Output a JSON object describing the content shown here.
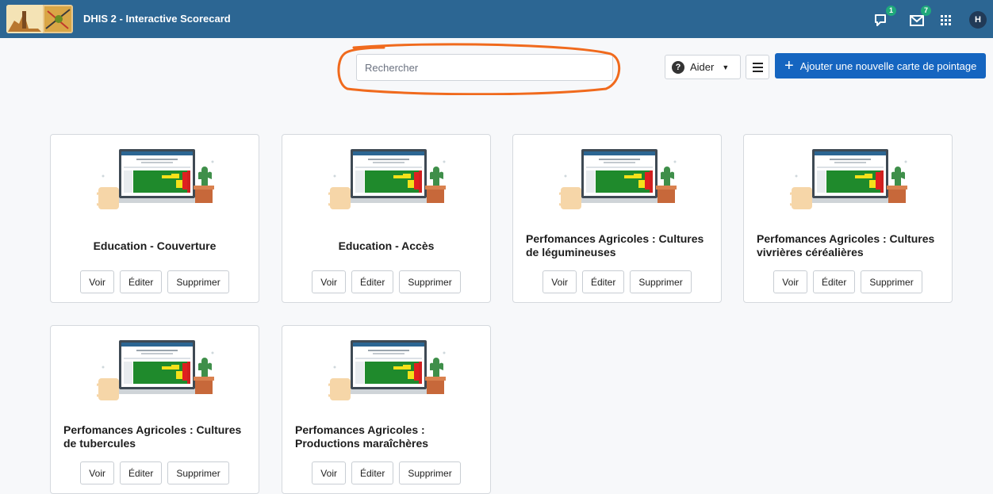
{
  "header": {
    "app_title": "DHIS 2 - Interactive Scorecard",
    "interpretations_badge": "1",
    "messages_badge": "7",
    "avatar_initial": "H"
  },
  "toolbar": {
    "search_placeholder": "Rechercher",
    "help_label": "Aider",
    "add_label": "Ajouter une nouvelle carte de pointage"
  },
  "cards": [
    {
      "title": "Education - Couverture"
    },
    {
      "title": "Education - Accès"
    },
    {
      "title": "Perfomances Agricoles : Cultures de légumineuses"
    },
    {
      "title": "Perfomances Agricoles : Cultures vivrières céréalières"
    },
    {
      "title": "Perfomances Agricoles : Cultures de tubercules"
    },
    {
      "title": "Perfomances Agricoles : Productions maraîchères"
    }
  ],
  "card_actions": {
    "view": "Voir",
    "edit": "Éditer",
    "delete": "Supprimer"
  },
  "colors": {
    "header_bg": "#2c6693",
    "primary": "#1565c0",
    "annotation": "#f06a1d"
  }
}
